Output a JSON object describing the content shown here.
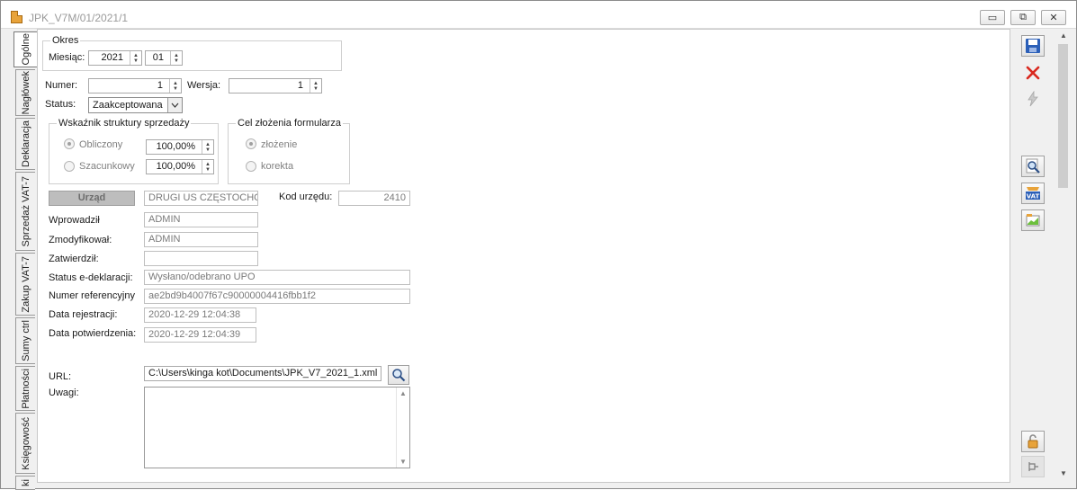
{
  "window": {
    "title": "JPK_V7M/01/2021/1",
    "minimize": "▭",
    "restore": "⧉",
    "close": "✕"
  },
  "tabs": [
    "Ogólne",
    "Nagłówek",
    "Deklaracja",
    "Sprzedaż VAT-7",
    "Zakup VAT-7",
    "Sumy ctrl",
    "Płatności",
    "Księgowość",
    "ki"
  ],
  "okres": {
    "group_title": "Okres",
    "miesiac_label": "Miesiąc:",
    "year": "2021",
    "month": "01"
  },
  "numer": {
    "label": "Numer:",
    "value": "1"
  },
  "wersja": {
    "label": "Wersja:",
    "value": "1"
  },
  "status": {
    "label": "Status:",
    "value": "Zaakceptowana"
  },
  "wskaznik": {
    "group_title": "Wskaźnik struktury sprzedaży",
    "obliczony_label": "Obliczony",
    "obliczony_value": "100,00%",
    "szacunkowy_label": "Szacunkowy",
    "szacunkowy_value": "100,00%"
  },
  "cel": {
    "group_title": "Cel złożenia formularza",
    "zlozenie_label": "złożenie",
    "korekta_label": "korekta"
  },
  "urzad": {
    "button": "Urząd",
    "value": "DRUGI US CZĘSTOCHOW"
  },
  "kod_urzedu": {
    "label": "Kod urzędu:",
    "value": "2410"
  },
  "wprowadzil": {
    "label": "Wprowadził",
    "value": "ADMIN"
  },
  "zmodyfikowal": {
    "label": "Zmodyfikował:",
    "value": "ADMIN"
  },
  "zatwierdzil": {
    "label": "Zatwierdził:",
    "value": ""
  },
  "status_edeklaracji": {
    "label": "Status e-deklaracji:",
    "value": "Wysłano/odebrano UPO"
  },
  "numer_ref": {
    "label": "Numer referencyjny",
    "value": "ae2bd9b4007f67c90000004416fbb1f2"
  },
  "data_rejestracji": {
    "label": "Data rejestracji:",
    "value": "2020-12-29 12:04:38"
  },
  "data_potwierdzenia": {
    "label": "Data potwierdzenia:",
    "value": "2020-12-29 12:04:39"
  },
  "url": {
    "label": "URL:",
    "value": "C:\\Users\\kinga kot\\Documents\\JPK_V7_2021_1.xml"
  },
  "uwagi": {
    "label": "Uwagi:",
    "value": ""
  },
  "toolbar_icons": [
    "save-icon",
    "delete-icon",
    "send-icon",
    "preview-icon",
    "vat-icon",
    "chart-icon",
    "lock-icon",
    "pin-icon"
  ],
  "colors": {
    "save_blue": "#2b5fb8",
    "delete_red": "#d9281e",
    "accent_orange": "#e8a33a"
  }
}
